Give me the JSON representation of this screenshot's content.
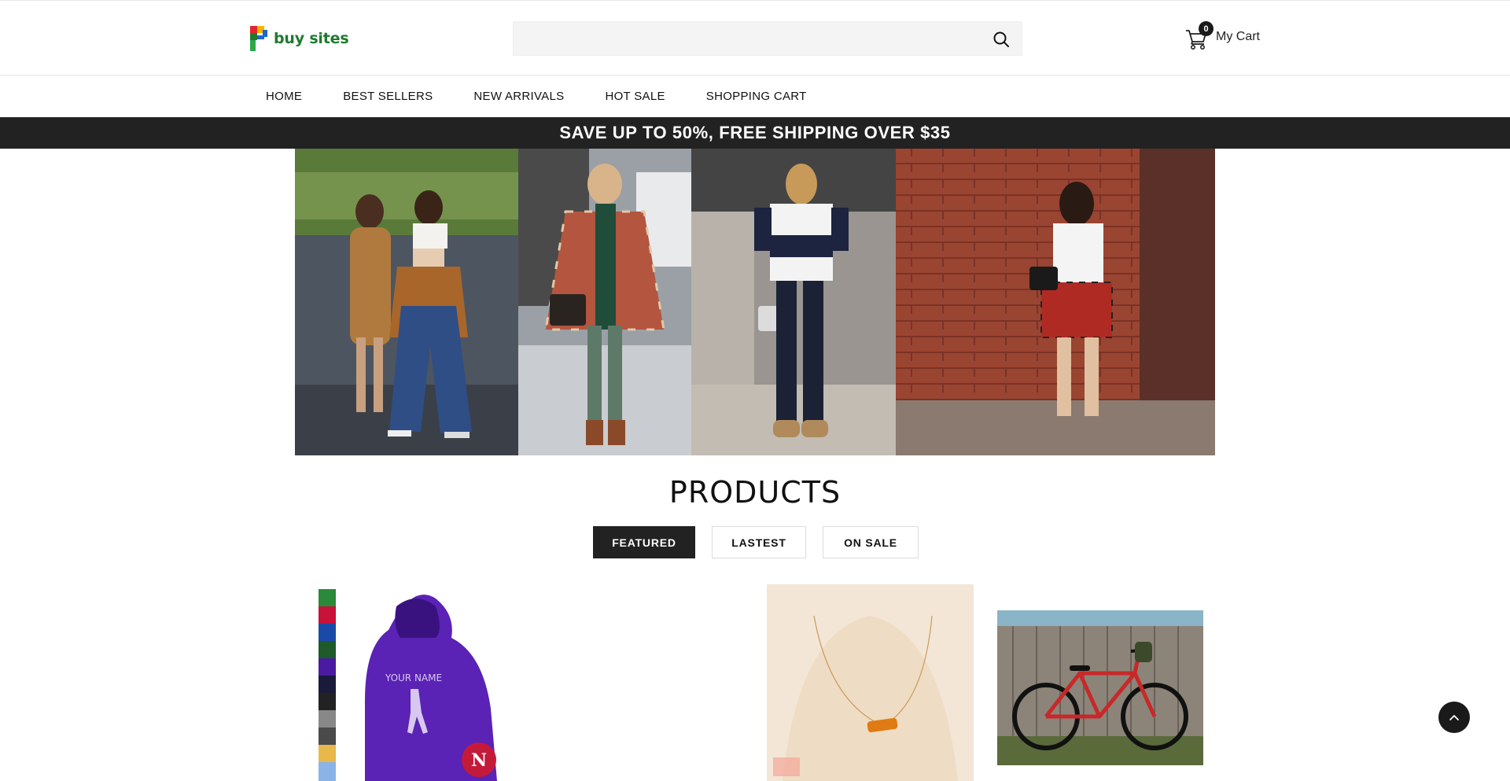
{
  "brand": {
    "name": "buy sites",
    "colors": [
      "#1f7a2e",
      "#e3262b",
      "#f5b400",
      "#1f66d1"
    ]
  },
  "search": {
    "placeholder": "",
    "icon": "search-icon"
  },
  "cart": {
    "label": "My Cart",
    "count": "0",
    "icon": "cart-icon"
  },
  "nav": {
    "items": [
      "HOME",
      "BEST SELLERS",
      "NEW ARRIVALS",
      "HOT SALE",
      "SHOPPING CART"
    ]
  },
  "promo": {
    "text": "SAVE UP TO 50%, FREE SHIPPING OVER $35"
  },
  "products": {
    "title": "PRODUCTS",
    "tabs": [
      {
        "label": "FEATURED",
        "active": true
      },
      {
        "label": "LASTEST",
        "active": false
      },
      {
        "label": "ON SALE",
        "active": false
      }
    ],
    "items": [
      {
        "image": "purple-hoodie",
        "print": "YOUR NAME"
      },
      {
        "image": "gold-necklace"
      },
      {
        "image": "red-bicycle"
      }
    ]
  },
  "colors": {
    "accent": "#222222",
    "promo_bg": "#222222",
    "hoodie": "#5a22b5"
  }
}
